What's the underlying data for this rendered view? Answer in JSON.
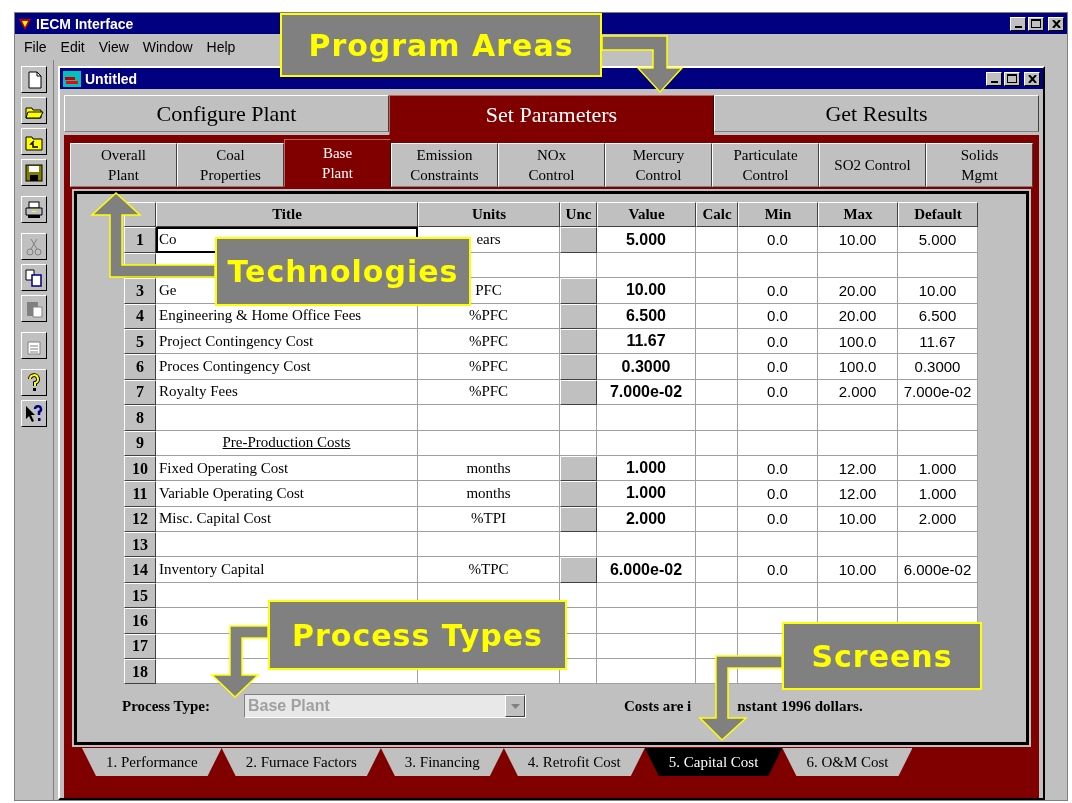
{
  "window": {
    "title": "IECM Interface"
  },
  "menu": [
    "File",
    "Edit",
    "View",
    "Window",
    "Help"
  ],
  "toolbar": [
    {
      "kind": "new",
      "disabled": false
    },
    {
      "kind": "open",
      "disabled": false
    },
    {
      "kind": "folder-up",
      "disabled": false
    },
    {
      "kind": "save",
      "disabled": false
    },
    {
      "kind": "print",
      "disabled": false
    },
    {
      "kind": "cut",
      "disabled": true
    },
    {
      "kind": "copy",
      "disabled": false
    },
    {
      "kind": "paste",
      "disabled": true
    },
    {
      "kind": "properties",
      "disabled": true
    },
    {
      "kind": "help",
      "disabled": false
    },
    {
      "kind": "context-help",
      "disabled": false
    }
  ],
  "document": {
    "title": "Untitled"
  },
  "program_tabs": [
    {
      "label": "Configure Plant",
      "selected": false
    },
    {
      "label": "Set Parameters",
      "selected": true
    },
    {
      "label": "Get Results",
      "selected": false
    }
  ],
  "technology_tabs": [
    {
      "label": "Overall\nPlant",
      "selected": false
    },
    {
      "label": "Coal\nProperties",
      "selected": false
    },
    {
      "label": "Base\nPlant",
      "selected": true
    },
    {
      "label": "Emission\nConstraints",
      "selected": false
    },
    {
      "label": "NOx\nControl",
      "selected": false
    },
    {
      "label": "Mercury\nControl",
      "selected": false
    },
    {
      "label": "Particulate\nControl",
      "selected": false
    },
    {
      "label": "SO2 Control",
      "selected": false
    },
    {
      "label": "Solids\nMgmt",
      "selected": false
    }
  ],
  "table": {
    "columns": [
      "Title",
      "Units",
      "Unc",
      "Value",
      "Calc",
      "Min",
      "Max",
      "Default"
    ],
    "rows": [
      {
        "num": "1",
        "kind": "parameter",
        "current": true,
        "title": "Co",
        "units": "ears",
        "value": "5.000",
        "min": "0.0",
        "max": "10.00",
        "default": "5.000"
      },
      {
        "kind": "blank",
        "current": false
      },
      {
        "num": "3",
        "kind": "parameter",
        "current": false,
        "title": "Ge",
        "units": "PFC",
        "value": "10.00",
        "min": "0.0",
        "max": "20.00",
        "default": "10.00"
      },
      {
        "num": "4",
        "kind": "parameter",
        "current": false,
        "title": "Engineering & Home Office Fees",
        "units": "%PFC",
        "value": "6.500",
        "min": "0.0",
        "max": "20.00",
        "default": "6.500"
      },
      {
        "num": "5",
        "kind": "parameter",
        "current": false,
        "title": "Project Contingency Cost",
        "units": "%PFC",
        "value": "11.67",
        "min": "0.0",
        "max": "100.0",
        "default": "11.67"
      },
      {
        "num": "6",
        "kind": "parameter",
        "current": false,
        "title": "Proces Contingency Cost",
        "units": "%PFC",
        "value": "0.3000",
        "min": "0.0",
        "max": "100.0",
        "default": "0.3000"
      },
      {
        "num": "7",
        "kind": "parameter",
        "current": false,
        "title": "Royalty Fees",
        "units": "%PFC",
        "value": "7.000e-02",
        "min": "0.0",
        "max": "2.000",
        "default": "7.000e-02"
      },
      {
        "num": "8",
        "kind": "blank",
        "current": false
      },
      {
        "num": "9",
        "kind": "heading",
        "current": false,
        "title": "Pre-Production Costs"
      },
      {
        "num": "10",
        "kind": "parameter",
        "current": false,
        "title": "Fixed Operating Cost",
        "units": "months",
        "value": "1.000",
        "min": "0.0",
        "max": "12.00",
        "default": "1.000"
      },
      {
        "num": "11",
        "kind": "parameter",
        "current": false,
        "title": "Variable Operating Cost",
        "units": "months",
        "value": "1.000",
        "min": "0.0",
        "max": "12.00",
        "default": "1.000"
      },
      {
        "num": "12",
        "kind": "parameter",
        "current": false,
        "title": "Misc. Capital Cost",
        "units": "%TPI",
        "value": "2.000",
        "min": "0.0",
        "max": "10.00",
        "default": "2.000"
      },
      {
        "num": "13",
        "kind": "blank",
        "current": false
      },
      {
        "num": "14",
        "kind": "parameter",
        "current": false,
        "title": "Inventory Capital",
        "units": "%TPC",
        "value": "6.000e-02",
        "min": "0.0",
        "max": "10.00",
        "default": "6.000e-02"
      },
      {
        "num": "15",
        "kind": "blank",
        "current": false
      },
      {
        "num": "16",
        "kind": "blank",
        "current": false
      },
      {
        "num": "17",
        "kind": "blank",
        "current": false
      },
      {
        "num": "18",
        "kind": "blank",
        "current": false
      }
    ]
  },
  "process_type": {
    "label": "Process Type:",
    "value": "Base Plant",
    "disabled": true
  },
  "note": [
    "Costs are i",
    "nstant 1996 dollars."
  ],
  "screen_tabs": [
    {
      "label": "1. Performance",
      "selected": false
    },
    {
      "label": "2. Furnace Factors",
      "selected": false
    },
    {
      "label": "3. Financing",
      "selected": false
    },
    {
      "label": "4. Retrofit Cost",
      "selected": false
    },
    {
      "label": "5. Capital Cost",
      "selected": true
    },
    {
      "label": "6. O&M Cost",
      "selected": false
    }
  ],
  "callouts": [
    {
      "kind": "program-areas",
      "text": "Program Areas"
    },
    {
      "kind": "technologies",
      "text": "Technologies"
    },
    {
      "kind": "process-types",
      "text": "Process Types"
    },
    {
      "kind": "screens",
      "text": "Screens"
    }
  ]
}
